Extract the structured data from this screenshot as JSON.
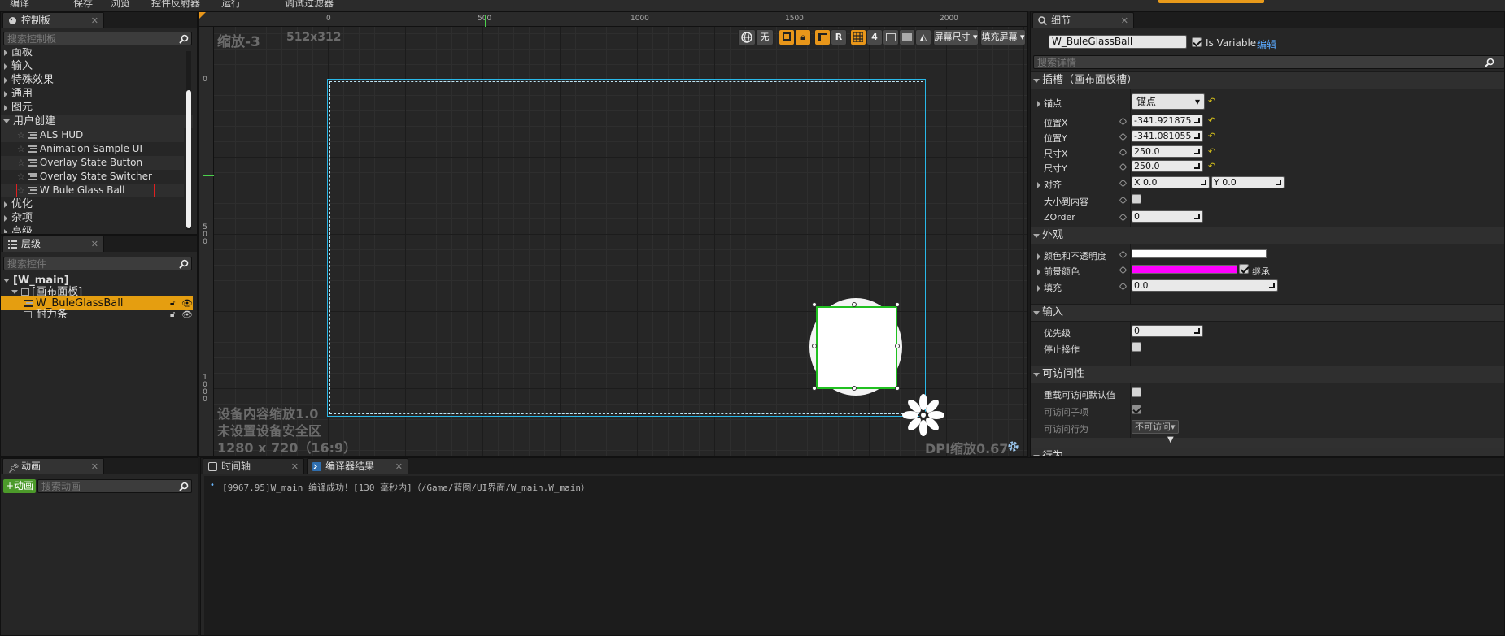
{
  "topbar": {
    "items": [
      "编译",
      "保存",
      "浏览",
      "控件反射器",
      "运行",
      "调试过滤器"
    ]
  },
  "palette": {
    "tab": "控制板",
    "search_placeholder": "搜索控制板",
    "categories": [
      {
        "label": "面板"
      },
      {
        "label": "输入"
      },
      {
        "label": "特殊效果"
      },
      {
        "label": "通用"
      },
      {
        "label": "图元"
      }
    ],
    "user_created": {
      "label": "用户创建",
      "items": [
        "ALS HUD",
        "Animation Sample UI",
        "Overlay State Button",
        "Overlay State Switcher",
        "W Bule Glass Ball"
      ]
    },
    "after": [
      {
        "label": "优化"
      },
      {
        "label": "杂项"
      },
      {
        "label": "高级"
      }
    ]
  },
  "hierarchy": {
    "tab": "层级",
    "search_placeholder": "搜索控件",
    "root": "[W_main]",
    "canvas": "[画布面板]",
    "selected": "W_BuleGlassBall",
    "item": "耐力条"
  },
  "designer": {
    "zoom": "缩放-3",
    "resolution": "512x312",
    "ruler_labels": [
      "0",
      "500",
      "1000",
      "1500",
      "2000"
    ],
    "vruler_labels": [
      "0",
      "5\n0\n0",
      "1\n0\n0\n0"
    ],
    "toolbar": {
      "none": "无",
      "r": "R",
      "grid_num": "4",
      "screen_size": "屏幕尺寸",
      "fill_screen": "填充屏幕"
    },
    "overlay_lines": [
      "设备内容缩放1.0",
      "未设置设备安全区",
      "1280 x 720（16:9）"
    ],
    "dpi": "DPI缩放0.67"
  },
  "details": {
    "tab": "细节",
    "name": "W_BuleGlassBall",
    "is_variable_label": "Is Variable",
    "is_variable": true,
    "edit_link": "编辑",
    "search_placeholder": "搜索详情",
    "slot_section": "插槽（画布面板槽）",
    "anchor_label": "锚点",
    "anchor_value": "锚点",
    "pos_x_label": "位置X",
    "pos_x": "-341.921875",
    "pos_y_label": "位置Y",
    "pos_y": "-341.081055",
    "size_x_label": "尺寸X",
    "size_x": "250.0",
    "size_y_label": "尺寸Y",
    "size_y": "250.0",
    "align_label": "对齐",
    "align_x": "X  0.0",
    "align_y": "Y  0.0",
    "size_to_content_label": "大小到内容",
    "zorder_label": "ZOrder",
    "zorder": "0",
    "appearance_section": "外观",
    "color_label": "颜色和不透明度",
    "color": "#ffffff",
    "fg_label": "前景颜色",
    "fg_color": "#ff00ff",
    "inherit_label": "继承",
    "padding_label": "填充",
    "padding": "0.0",
    "input_section": "输入",
    "priority_label": "优先级",
    "priority": "0",
    "stop_label": "停止操作",
    "access_section": "可访问性",
    "override_label": "重载可访问默认值",
    "children_label": "可访问子项",
    "behavior_label": "可访问行为",
    "behavior_value": "不可访问",
    "behavior_section_cut": "行为"
  },
  "animation": {
    "tab": "动画",
    "add_btn": "+动画",
    "search_placeholder": "搜索动画"
  },
  "bottom_tabs": {
    "timeline": "时间轴",
    "compiler": "编译器结果"
  },
  "log": {
    "line": "[9967.95]W_main 编译成功！[130 毫秒内]（/Game/蓝图/UI界面/W_main.W_main）"
  }
}
